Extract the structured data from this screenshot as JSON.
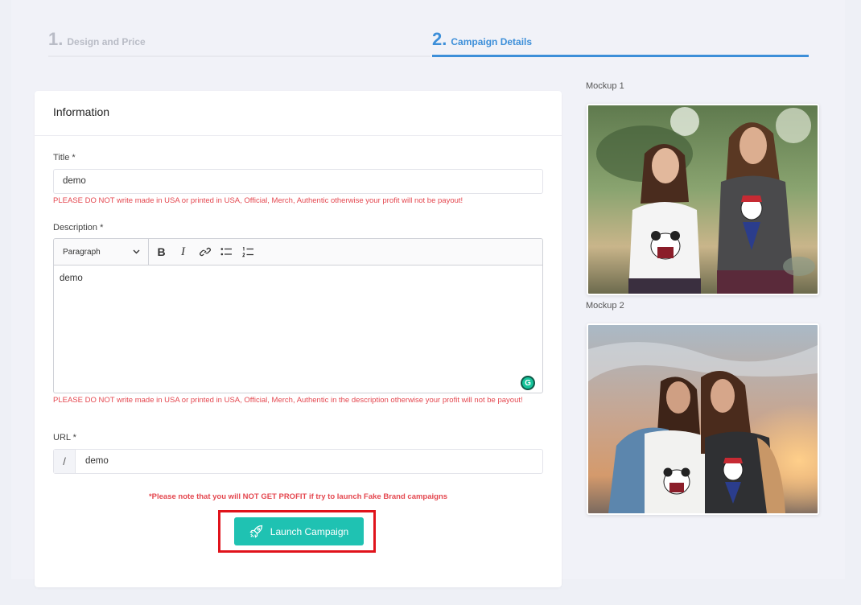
{
  "steps": [
    {
      "num": "1.",
      "label": "Design and Price",
      "active": false
    },
    {
      "num": "2.",
      "label": "Campaign Details",
      "active": true
    }
  ],
  "form": {
    "heading": "Information",
    "title": {
      "label": "Title *",
      "value": "demo",
      "warning": "PLEASE DO NOT write made in USA or printed in USA, Official, Merch, Authentic otherwise your profit will not be payout!"
    },
    "description": {
      "label": "Description *",
      "format_select": "Paragraph",
      "value": "demo",
      "warning": "PLEASE DO NOT write made in USA or printed in USA, Official, Merch, Authentic in the description otherwise your profit will not be payout!"
    },
    "url": {
      "label": "URL *",
      "prefix": "/",
      "value": "demo"
    },
    "fake_brand_note": "*Please note that you will NOT GET PROFIT if try to launch Fake Brand campaigns",
    "launch_label": "Launch Campaign"
  },
  "mockups": [
    {
      "label": "Mockup 1"
    },
    {
      "label": "Mockup 2"
    }
  ],
  "colors": {
    "accent": "#3d8fd9",
    "launch": "#1fc2b2",
    "warning": "#e4474f",
    "highlight": "#e0131b"
  }
}
